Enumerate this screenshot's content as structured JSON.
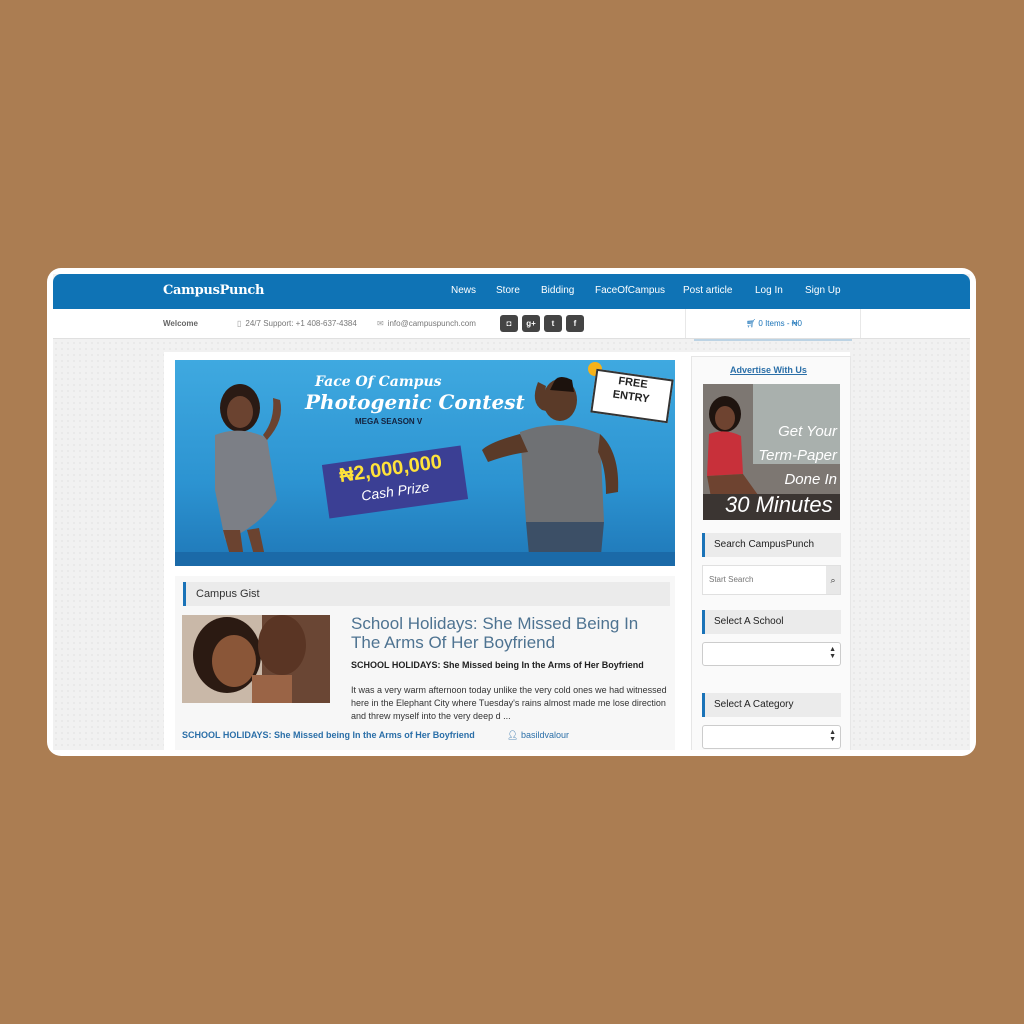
{
  "header": {
    "logo": "CampusPunch",
    "nav": [
      "News",
      "Store",
      "Bidding",
      "FaceOfCampus",
      "Post article",
      "Log In",
      "Sign Up"
    ]
  },
  "infobar": {
    "welcome": "Welcome",
    "support": "24/7 Support: +1 408-637-4384",
    "email": "info@campuspunch.com",
    "social": [
      "instagram-icon",
      "google-plus-icon",
      "twitter-icon",
      "facebook-icon"
    ],
    "cart": "0 Items - ₦0"
  },
  "banner": {
    "title_line1": "Face Of Campus",
    "title_line2": "Photogenic Contest",
    "season": "MEGA SEASON V",
    "prize_amount": "₦2,000,000",
    "prize_label": "Cash Prize",
    "free_line1": "FREE",
    "free_line2": "ENTRY"
  },
  "gist": {
    "heading": "Campus Gist",
    "post_title": "School Holidays: She Missed Being In The Arms Of Her Boyfriend",
    "post_subtitle": "SCHOOL HOLIDAYS: She Missed being In the Arms of Her Boyfriend",
    "post_excerpt": "It was a very warm afternoon today unlike the very cold ones we had witnessed here in the Elephant City where Tuesday's rains almost made me lose direction and threw myself into the very deep d ...",
    "post_link": "SCHOOL HOLIDAYS: She Missed being In the Arms of Her Boyfriend",
    "author": "basildvalour"
  },
  "sidebar": {
    "advertise": "Advertise With Us",
    "ad_line1": "Get Your",
    "ad_line2": "Term-Paper",
    "ad_line3": "Done In",
    "ad_line4": "30 Minutes",
    "search_heading": "Search CampusPunch",
    "search_placeholder": "Start Search",
    "school_heading": "Select A School",
    "category_heading": "Select A Category"
  },
  "colors": {
    "page_bg": "#ab7d52",
    "brand_blue": "#0f73b5",
    "link_blue": "#2b6fa8"
  }
}
